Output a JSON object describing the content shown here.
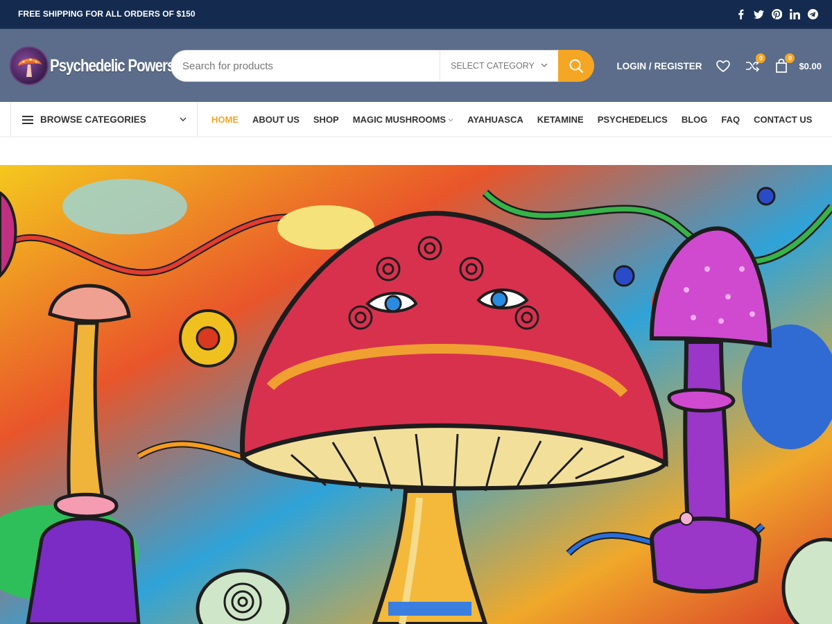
{
  "topbar": {
    "promo": "FREE SHIPPING FOR ALL ORDERS OF $150",
    "social": [
      "facebook-icon",
      "twitter-icon",
      "pinterest-icon",
      "linkedin-icon",
      "telegram-icon"
    ]
  },
  "header": {
    "logo_text": "Psychedelic Powers",
    "search": {
      "placeholder": "Search for products",
      "category_label": "SELECT CATEGORY"
    },
    "login_label": "LOGIN / REGISTER",
    "compare_count": "0",
    "cart_count": "0",
    "cart_total": "$0.00"
  },
  "nav": {
    "browse_label": "BROWSE CATEGORIES",
    "items": [
      {
        "label": "HOME",
        "active": true
      },
      {
        "label": "ABOUT US"
      },
      {
        "label": "SHOP"
      },
      {
        "label": "MAGIC MUSHROOMS",
        "dropdown": true
      },
      {
        "label": "AYAHUASCA"
      },
      {
        "label": "KETAMINE"
      },
      {
        "label": "PSYCHEDELICS"
      },
      {
        "label": "BLOG"
      },
      {
        "label": "FAQ"
      },
      {
        "label": "CONTACT US"
      }
    ]
  },
  "colors": {
    "topbar": "#142b4f",
    "header": "#5b6d8a",
    "accent": "#f5a623"
  }
}
